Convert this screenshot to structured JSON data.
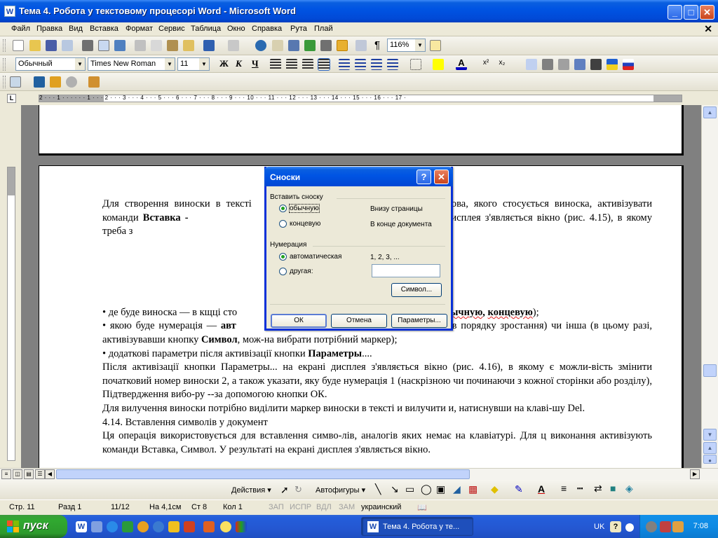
{
  "window": {
    "title": "Тема 4. Робота у текстовому процесорі Word - Microsoft Word",
    "app_icon": "W"
  },
  "menu": [
    "Файл",
    "Правка",
    "Вид",
    "Вставка",
    "Формат",
    "Сервис",
    "Таблица",
    "Окно",
    "Справка",
    "Рута",
    "Плай"
  ],
  "toolbar": {
    "zoom": "116%",
    "style": "Обычный",
    "font": "Times New Roman",
    "size": "11",
    "bold": "Ж",
    "italic": "К",
    "underline": "Ч"
  },
  "ruler": {
    "numbers": "2 · · · 1 · · · · · · 1 · · · 2 · · · 3 · · · 4 · · · 5 · · · 6 · · · 7 · · · 8 · · · 9 · · · 10 · · · 11 · · · 12 · · · 13 · · · 14 · · · 15 · · · 16 · · · 17 ·"
  },
  "document": {
    "p1_a": "Для створення виноски в тексті ",
    "p1_b": "еля слова, якого стосується виноска, активізувати команди ",
    "p1_bold": "Вставка -",
    "p1_c": " езультаті на екрані дисплея з'являється вікно (рис. 4.15), в якому треба з",
    "b1_a": "•  де буде виноска — в кщці сто",
    "b1_b": "и — ",
    "b1_bold1": "обычную",
    "b1_sep": ", ",
    "b1_bold2": "концевую",
    "b1_end": ");",
    "b2_a": "•   якою буде нумерація — ",
    "b2_bold": "авт",
    "b2_b": "ифри в порядку зростання) чи інша (в цьому разі, активізувавши кнопку ",
    "b2_bold2": "Символ",
    "b2_c": ", мож-на вибрати потрібний маркер);",
    "b3_a": "•  додаткові параметри після активізації кнопки ",
    "b3_bold": "Параметры",
    "b3_b": "....",
    "p2": "Після активізації кнопки Параметры... на екрані дисплея з'являється вікно (рис. 4.16), в якому є можли-вість змінити початковий номер виноски 2, а також указати, яку буде нумерація 1 (наскрізною чи починаючи з кожної сторінки або розділу), Підтвердження вибо-ру --за допомогою кнопки ОК.",
    "p3": "Для вилучення виноски потрібно виділити маркер виноски в тексті и вилучити и, натиснувши на клаві-шу Del.",
    "p4": "4.14. Вставлення символів у документ",
    "p5": "Ця операція використовується для вставлення симво-лів, аналогів яких немає на клавіатурі. Для ц виконання активізують команди Вставка, Символ. У результаті на екрані дисплея з'являється вікно."
  },
  "dialog": {
    "title": "Сноски",
    "insert_group": "Вставить сноску",
    "opt_normal": "обычную",
    "opt_normal_desc": "Внизу страницы",
    "opt_end": "концевую",
    "opt_end_desc": "В конце документа",
    "numbering_group": "Нумерация",
    "opt_auto": "автоматическая",
    "opt_auto_desc": "1, 2, 3, ...",
    "opt_other": "другая:",
    "other_value": "",
    "symbol_btn": "Символ...",
    "ok_btn": "ОК",
    "cancel_btn": "Отмена",
    "params_btn": "Параметры..."
  },
  "drawbar": {
    "actions": "Действия ▾",
    "autoshapes": "Автофигуры ▾"
  },
  "status": {
    "page": "Стр. 11",
    "section": "Разд 1",
    "pages": "11/12",
    "at": "На 4,1см",
    "line": "Ст 8",
    "col": "Кол 1",
    "rec": "ЗАП",
    "trk": "ИСПР",
    "ext": "ВДЛ",
    "ovr": "ЗАМ",
    "lang": "украинский"
  },
  "taskbar": {
    "start": "пуск",
    "task": "Тема 4. Робота у те...",
    "lang": "UK",
    "clock": "7:08"
  }
}
